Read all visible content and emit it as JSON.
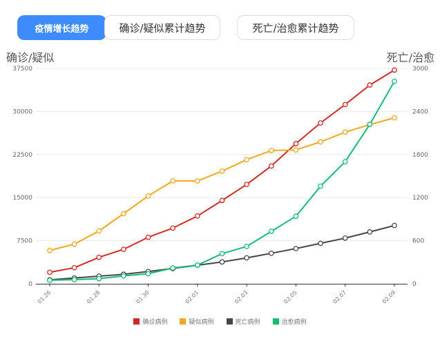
{
  "tabs": [
    {
      "label": "疫情增长趋势",
      "active": true
    },
    {
      "label": "确诊/疑似累计趋势",
      "active": false
    },
    {
      "label": "死亡/治愈累计趋势",
      "active": false
    }
  ],
  "colors": {
    "active_tab": "#3d8bff",
    "confirmed": "#d12a25",
    "suspected": "#f0a81f",
    "deaths": "#474747",
    "recovered": "#13bb73"
  },
  "chart_data": {
    "type": "line",
    "title": "",
    "y_left_label": "确诊/疑似",
    "y_right_label": "死亡/治愈",
    "x": [
      "01.26",
      "01.27",
      "01.28",
      "01.29",
      "01.30",
      "01.31",
      "02.01",
      "02.02",
      "02.03",
      "02.04",
      "02.05",
      "02.06",
      "02.07",
      "02.08",
      "02.09"
    ],
    "x_tick_labels": [
      "01.26",
      "01.28",
      "01.30",
      "02.01",
      "02.03",
      "02.05",
      "02.07",
      "02.09"
    ],
    "y_left_range": [
      0,
      37500
    ],
    "y_left_ticks": [
      0,
      7500,
      15000,
      22500,
      30000,
      37500
    ],
    "y_right_range": [
      0,
      3000
    ],
    "y_right_ticks": [
      0,
      600,
      1200,
      1800,
      2400,
      3000
    ],
    "grid": true,
    "legend_position": "bottom-center",
    "series": [
      {
        "name": "确诊病例",
        "axis": "left",
        "color": "#d12a25",
        "values": [
          2000,
          2800,
          4600,
          6000,
          8100,
          9700,
          11800,
          14500,
          17300,
          20500,
          24400,
          28000,
          31200,
          34600,
          37200
        ]
      },
      {
        "name": "疑似病例",
        "axis": "left",
        "color": "#f0a81f",
        "values": [
          5800,
          6900,
          9200,
          12200,
          15300,
          17900,
          17900,
          19600,
          21600,
          23200,
          23300,
          24700,
          26400,
          27700,
          28900
        ]
      },
      {
        "name": "死亡病例",
        "axis": "right",
        "color": "#474747",
        "values": [
          56,
          81,
          106,
          132,
          170,
          213,
          259,
          304,
          361,
          425,
          490,
          563,
          636,
          722,
          812
        ]
      },
      {
        "name": "治愈病例",
        "axis": "right",
        "color": "#13bb73",
        "values": [
          49,
          58,
          71,
          110,
          140,
          220,
          260,
          420,
          520,
          730,
          940,
          1360,
          1700,
          2220,
          2820
        ]
      }
    ]
  }
}
